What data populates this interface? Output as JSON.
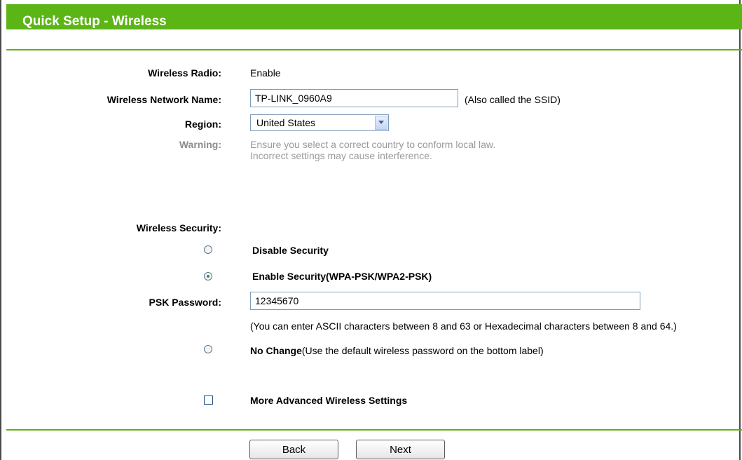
{
  "header": {
    "title": "Quick Setup - Wireless"
  },
  "wireless_radio": {
    "label": "Wireless Radio:",
    "value": "Enable"
  },
  "network_name": {
    "label": "Wireless Network Name:",
    "value": "TP-LINK_0960A9",
    "hint": "(Also called the SSID)"
  },
  "region": {
    "label": "Region:",
    "selected": "United States"
  },
  "warning": {
    "label": "Warning:",
    "line1": "Ensure you select a correct country to conform local law.",
    "line2": "Incorrect settings may cause interference."
  },
  "security": {
    "label": "Wireless Security:",
    "disable_label": "Disable Security",
    "enable_label": "Enable Security(WPA-PSK/WPA2-PSK)",
    "selected": "enable",
    "psk_label": "PSK Password:",
    "psk_value": "12345670",
    "psk_hint": "(You can enter ASCII characters between 8 and 63 or Hexadecimal characters between 8 and 64.)",
    "no_change_bold": "No Change",
    "no_change_rest": "(Use the default wireless password on the bottom label)"
  },
  "advanced": {
    "label": "More Advanced Wireless Settings",
    "checked": false
  },
  "buttons": {
    "back": "Back",
    "next": "Next"
  },
  "colors": {
    "accent": "#5bb515",
    "muted_text": "#9a9a9a"
  }
}
